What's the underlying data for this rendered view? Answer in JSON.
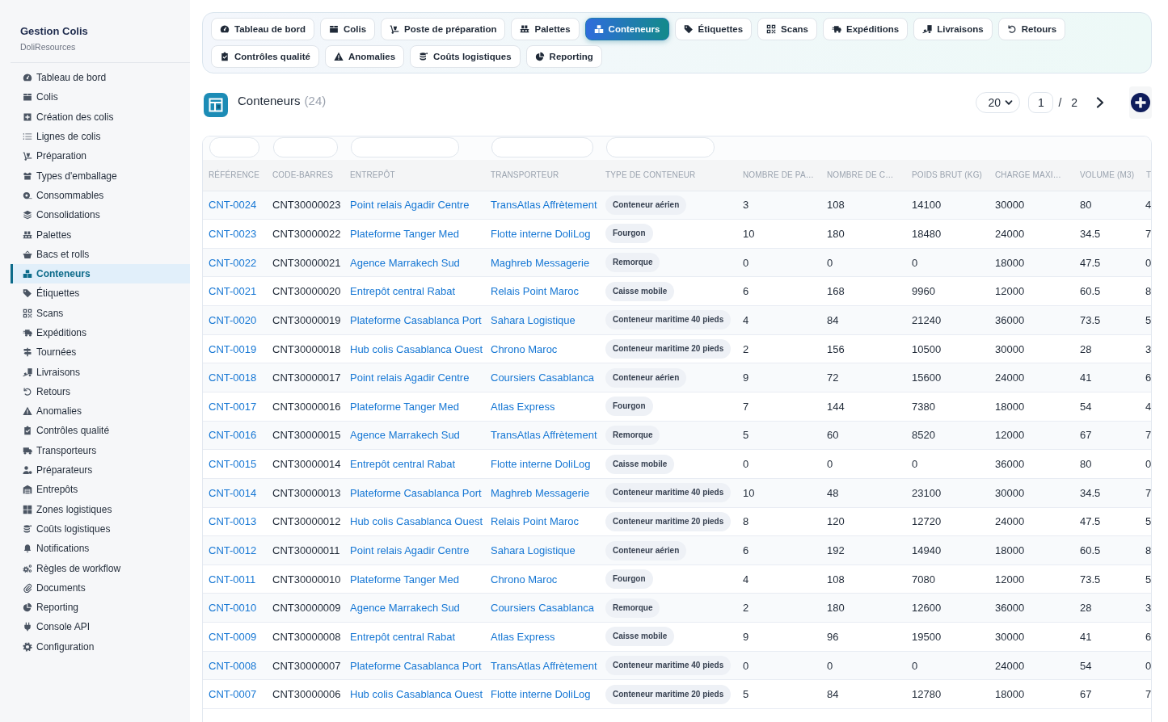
{
  "sidebar": {
    "title": "Gestion Colis",
    "subtitle": "DoliResources",
    "items": [
      {
        "label": "Tableau de bord",
        "selected": false
      },
      {
        "label": "Colis",
        "selected": false
      },
      {
        "label": "Création des colis",
        "selected": false
      },
      {
        "label": "Lignes de colis",
        "selected": false
      },
      {
        "label": "Préparation",
        "selected": false
      },
      {
        "label": "Types d'emballage",
        "selected": false
      },
      {
        "label": "Consommables",
        "selected": false
      },
      {
        "label": "Consolidations",
        "selected": false
      },
      {
        "label": "Palettes",
        "selected": false
      },
      {
        "label": "Bacs et rolls",
        "selected": false
      },
      {
        "label": "Conteneurs",
        "selected": true
      },
      {
        "label": "Étiquettes",
        "selected": false
      },
      {
        "label": "Scans",
        "selected": false
      },
      {
        "label": "Expéditions",
        "selected": false
      },
      {
        "label": "Tournées",
        "selected": false
      },
      {
        "label": "Livraisons",
        "selected": false
      },
      {
        "label": "Retours",
        "selected": false
      },
      {
        "label": "Anomalies",
        "selected": false
      },
      {
        "label": "Contrôles qualité",
        "selected": false
      },
      {
        "label": "Transporteurs",
        "selected": false
      },
      {
        "label": "Préparateurs",
        "selected": false
      },
      {
        "label": "Entrepôts",
        "selected": false
      },
      {
        "label": "Zones logistiques",
        "selected": false
      },
      {
        "label": "Coûts logistiques",
        "selected": false
      },
      {
        "label": "Notifications",
        "selected": false
      },
      {
        "label": "Règles de workflow",
        "selected": false
      },
      {
        "label": "Documents",
        "selected": false
      },
      {
        "label": "Reporting",
        "selected": false
      },
      {
        "label": "Console API",
        "selected": false
      },
      {
        "label": "Configuration",
        "selected": false
      }
    ]
  },
  "tabs": [
    {
      "label": "Tableau de bord",
      "selected": false
    },
    {
      "label": "Colis",
      "selected": false
    },
    {
      "label": "Poste de préparation",
      "selected": false
    },
    {
      "label": "Palettes",
      "selected": false
    },
    {
      "label": "Conteneurs",
      "selected": true
    },
    {
      "label": "Étiquettes",
      "selected": false
    },
    {
      "label": "Scans",
      "selected": false
    },
    {
      "label": "Expéditions",
      "selected": false
    },
    {
      "label": "Livraisons",
      "selected": false
    },
    {
      "label": "Retours",
      "selected": false
    },
    {
      "label": "Contrôles qualité",
      "selected": false
    },
    {
      "label": "Anomalies",
      "selected": false
    },
    {
      "label": "Coûts logistiques",
      "selected": false
    },
    {
      "label": "Reporting",
      "selected": false
    }
  ],
  "header": {
    "title": "Conteneurs",
    "count": "(24)",
    "page_size": "20",
    "page": "1",
    "page_total": "/ 2"
  },
  "table": {
    "columns": [
      {
        "label": "RÉFÉRENCE",
        "kind": "link",
        "filterable": true
      },
      {
        "label": "CODE-BARRES",
        "kind": "text",
        "filterable": true
      },
      {
        "label": "ENTREPÔT",
        "kind": "link",
        "filterable": true
      },
      {
        "label": "TRANSPORTEUR",
        "kind": "link",
        "filterable": true
      },
      {
        "label": "TYPE DE CONTENEUR",
        "kind": "badge",
        "filterable": true
      },
      {
        "label": "NOMBRE DE PA…",
        "kind": "text",
        "filterable": false
      },
      {
        "label": "NOMBRE DE C…",
        "kind": "text",
        "filterable": false
      },
      {
        "label": "POIDS BRUT (KG)",
        "kind": "text",
        "filterable": false
      },
      {
        "label": "CHARGE MAXI…",
        "kind": "text",
        "filterable": false
      },
      {
        "label": "VOLUME (M3)",
        "kind": "text",
        "filterable": false
      },
      {
        "label": "T",
        "kind": "text",
        "filterable": false
      }
    ],
    "rows": [
      [
        "CNT-0024",
        "CNT30000023",
        "Point relais Agadir Centre",
        "TransAtlas Affrètement",
        "Conteneur aérien",
        "3",
        "108",
        "14100",
        "30000",
        "80",
        "4"
      ],
      [
        "CNT-0023",
        "CNT30000022",
        "Plateforme Tanger Med",
        "Flotte interne DoliLog",
        "Fourgon",
        "10",
        "180",
        "18480",
        "24000",
        "34.5",
        "7"
      ],
      [
        "CNT-0022",
        "CNT30000021",
        "Agence Marrakech Sud",
        "Maghreb Messagerie",
        "Remorque",
        "0",
        "0",
        "0",
        "18000",
        "47.5",
        "0"
      ],
      [
        "CNT-0021",
        "CNT30000020",
        "Entrepôt central Rabat",
        "Relais Point Maroc",
        "Caisse mobile",
        "6",
        "168",
        "9960",
        "12000",
        "60.5",
        "8"
      ],
      [
        "CNT-0020",
        "CNT30000019",
        "Plateforme Casablanca Port",
        "Sahara Logistique",
        "Conteneur maritime 40 pieds",
        "4",
        "84",
        "21240",
        "36000",
        "73.5",
        "5"
      ],
      [
        "CNT-0019",
        "CNT30000018",
        "Hub colis Casablanca Ouest",
        "Chrono Maroc",
        "Conteneur maritime 20 pieds",
        "2",
        "156",
        "10500",
        "30000",
        "28",
        "3"
      ],
      [
        "CNT-0018",
        "CNT30000017",
        "Point relais Agadir Centre",
        "Coursiers Casablanca",
        "Conteneur aérien",
        "9",
        "72",
        "15600",
        "24000",
        "41",
        "6"
      ],
      [
        "CNT-0017",
        "CNT30000016",
        "Plateforme Tanger Med",
        "Atlas Express",
        "Fourgon",
        "7",
        "144",
        "7380",
        "18000",
        "54",
        "4"
      ],
      [
        "CNT-0016",
        "CNT30000015",
        "Agence Marrakech Sud",
        "TransAtlas Affrètement",
        "Remorque",
        "5",
        "60",
        "8520",
        "12000",
        "67",
        "7"
      ],
      [
        "CNT-0015",
        "CNT30000014",
        "Entrepôt central Rabat",
        "Flotte interne DoliLog",
        "Caisse mobile",
        "0",
        "0",
        "0",
        "36000",
        "80",
        "0"
      ],
      [
        "CNT-0014",
        "CNT30000013",
        "Plateforme Casablanca Port",
        "Maghreb Messagerie",
        "Conteneur maritime 40 pieds",
        "10",
        "48",
        "23100",
        "30000",
        "34.5",
        "7"
      ],
      [
        "CNT-0013",
        "CNT30000012",
        "Hub colis Casablanca Ouest",
        "Relais Point Maroc",
        "Conteneur maritime 20 pieds",
        "8",
        "120",
        "12720",
        "24000",
        "47.5",
        "5"
      ],
      [
        "CNT-0012",
        "CNT30000011",
        "Point relais Agadir Centre",
        "Sahara Logistique",
        "Conteneur aérien",
        "6",
        "192",
        "14940",
        "18000",
        "60.5",
        "8"
      ],
      [
        "CNT-0011",
        "CNT30000010",
        "Plateforme Tanger Med",
        "Chrono Maroc",
        "Fourgon",
        "4",
        "108",
        "7080",
        "12000",
        "73.5",
        "5"
      ],
      [
        "CNT-0010",
        "CNT30000009",
        "Agence Marrakech Sud",
        "Coursiers Casablanca",
        "Remorque",
        "2",
        "180",
        "12600",
        "36000",
        "28",
        "3"
      ],
      [
        "CNT-0009",
        "CNT30000008",
        "Entrepôt central Rabat",
        "Atlas Express",
        "Caisse mobile",
        "9",
        "96",
        "19500",
        "30000",
        "41",
        "6"
      ],
      [
        "CNT-0008",
        "CNT30000007",
        "Plateforme Casablanca Port",
        "TransAtlas Affrètement",
        "Conteneur maritime 40 pieds",
        "0",
        "0",
        "0",
        "24000",
        "54",
        "0"
      ],
      [
        "CNT-0007",
        "CNT30000006",
        "Hub colis Casablanca Ouest",
        "Flotte interne DoliLog",
        "Conteneur maritime 20 pieds",
        "5",
        "84",
        "12780",
        "18000",
        "67",
        "7"
      ]
    ]
  }
}
